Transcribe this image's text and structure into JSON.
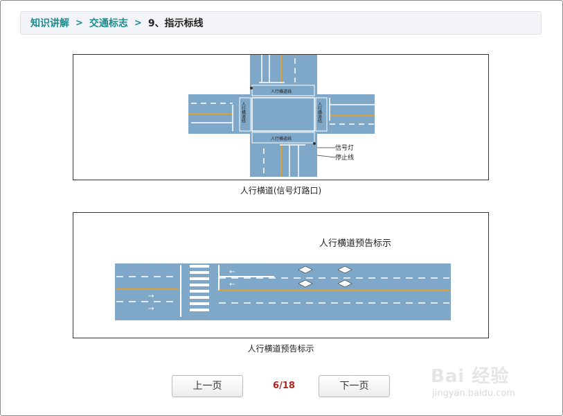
{
  "breadcrumb": {
    "items": [
      "知识讲解",
      "交通标志"
    ],
    "current": "9、指示标线",
    "separator": ">"
  },
  "figures": [
    {
      "caption": "人行横道(信号灯路口)",
      "labels": {
        "crosswalk": "人行横道线",
        "signal": "信号灯",
        "stop_line": "停止线"
      }
    },
    {
      "caption": "人行横道预告标示",
      "labels": {
        "title": "人行横道预告标示"
      }
    }
  ],
  "pager": {
    "prev_label": "上一页",
    "next_label": "下一页",
    "status": "6/18"
  },
  "watermark": {
    "logo": "Bai 经验",
    "url": "jingyan.baidu.com"
  },
  "colors": {
    "road": "#7ea7c8",
    "line_yellow": "#e0a030",
    "link": "#1e8a8f",
    "pager": "#b1231c"
  }
}
